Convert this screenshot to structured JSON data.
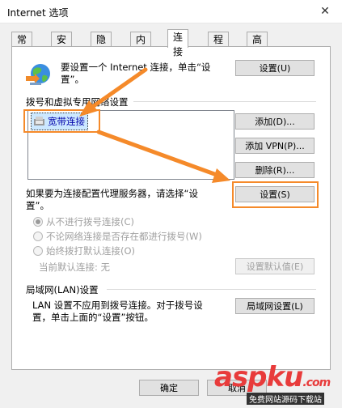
{
  "window": {
    "title": "Internet 选项",
    "close_glyph": "✕"
  },
  "tabs": [
    {
      "label": "常规"
    },
    {
      "label": "安全"
    },
    {
      "label": "隐私"
    },
    {
      "label": "内容"
    },
    {
      "label": "连接",
      "active": true
    },
    {
      "label": "程序"
    },
    {
      "label": "高级"
    }
  ],
  "setup": {
    "text_line1": "要设置一个 Internet 连接，单击“设",
    "text_line2": "置”。",
    "button": "设置(U)",
    "icon": "globe-connection-icon"
  },
  "dialup": {
    "heading": "拨号和虚拟专用网络设置",
    "items": [
      {
        "label": "宽带连接",
        "icon": "broadband-connection-icon"
      }
    ],
    "add_button": "添加(D)...",
    "add_vpn_button": "添加 VPN(P)...",
    "remove_button": "删除(R)...",
    "proxy_text_line1": "如果要为连接配置代理服务器，请选择“设",
    "proxy_text_line2": "置”。",
    "settings_button": "设置(S)",
    "options": [
      {
        "label": "从不进行拨号连接(C)",
        "checked": true
      },
      {
        "label": "不论网络连接是否存在都进行拨号(W)",
        "checked": false
      },
      {
        "label": "始终拨打默认连接(O)",
        "checked": false
      }
    ],
    "default_label": "当前默认连接:",
    "default_value": "无",
    "set_default_button": "设置默认值(E)"
  },
  "lan": {
    "heading": "局域网(LAN)设置",
    "text_line1": "LAN 设置不应用到拨号连接。对于拨号设",
    "text_line2": "置，单击上面的“设置”按钮。",
    "button": "局域网设置(L)"
  },
  "footer": {
    "ok_button": "确定",
    "cancel_button": "取消"
  },
  "watermark": {
    "brand": "aspku",
    "brand_suffix": ".com",
    "tagline": "免费网站源码下载站"
  },
  "colors": {
    "highlight": "#f58a2a",
    "watermark": "#e83b3b"
  }
}
